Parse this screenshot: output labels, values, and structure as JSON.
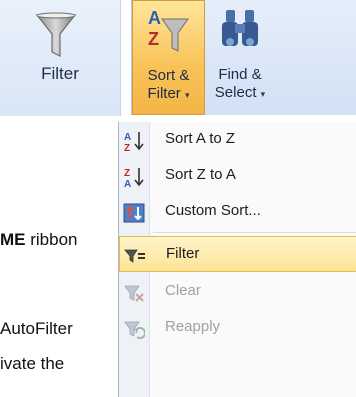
{
  "filter_panel": {
    "label": "Filter",
    "icon": "funnel-icon"
  },
  "ribbon": {
    "sort_filter": {
      "line1": "Sort &",
      "line2": "Filter",
      "caret": "▾",
      "icon": "sort-az-funnel-icon"
    },
    "find_select": {
      "line1": "Find &",
      "line2": "Select",
      "caret": "▾",
      "icon": "binoculars-icon"
    }
  },
  "menu": {
    "items": [
      {
        "id": "sort-a-to-z",
        "label": "Sort A to Z",
        "icon": "sort-az-icon",
        "enabled": true
      },
      {
        "id": "sort-z-to-a",
        "label": "Sort Z to A",
        "icon": "sort-za-icon",
        "enabled": true
      },
      {
        "id": "custom-sort",
        "label": "Custom Sort...",
        "icon": "custom-sort-icon",
        "enabled": true
      },
      {
        "id": "filter",
        "label": "Filter",
        "icon": "filter-icon",
        "enabled": true,
        "highlighted": true
      },
      {
        "id": "clear",
        "label": "Clear",
        "icon": "clear-filter-icon",
        "enabled": false
      },
      {
        "id": "reapply",
        "label": "Reapply",
        "icon": "reapply-filter-icon",
        "enabled": false
      }
    ]
  },
  "document": {
    "line1_bold": "ME",
    "line1_rest": " ribbon",
    "line2": "AutoFilter",
    "line3": "ivate the"
  },
  "colors": {
    "highlight": "#fde397",
    "highlight_border": "#e6bb4f",
    "ribbon_bg": "#d9e6f6",
    "disabled_text": "#a1a1a1"
  }
}
